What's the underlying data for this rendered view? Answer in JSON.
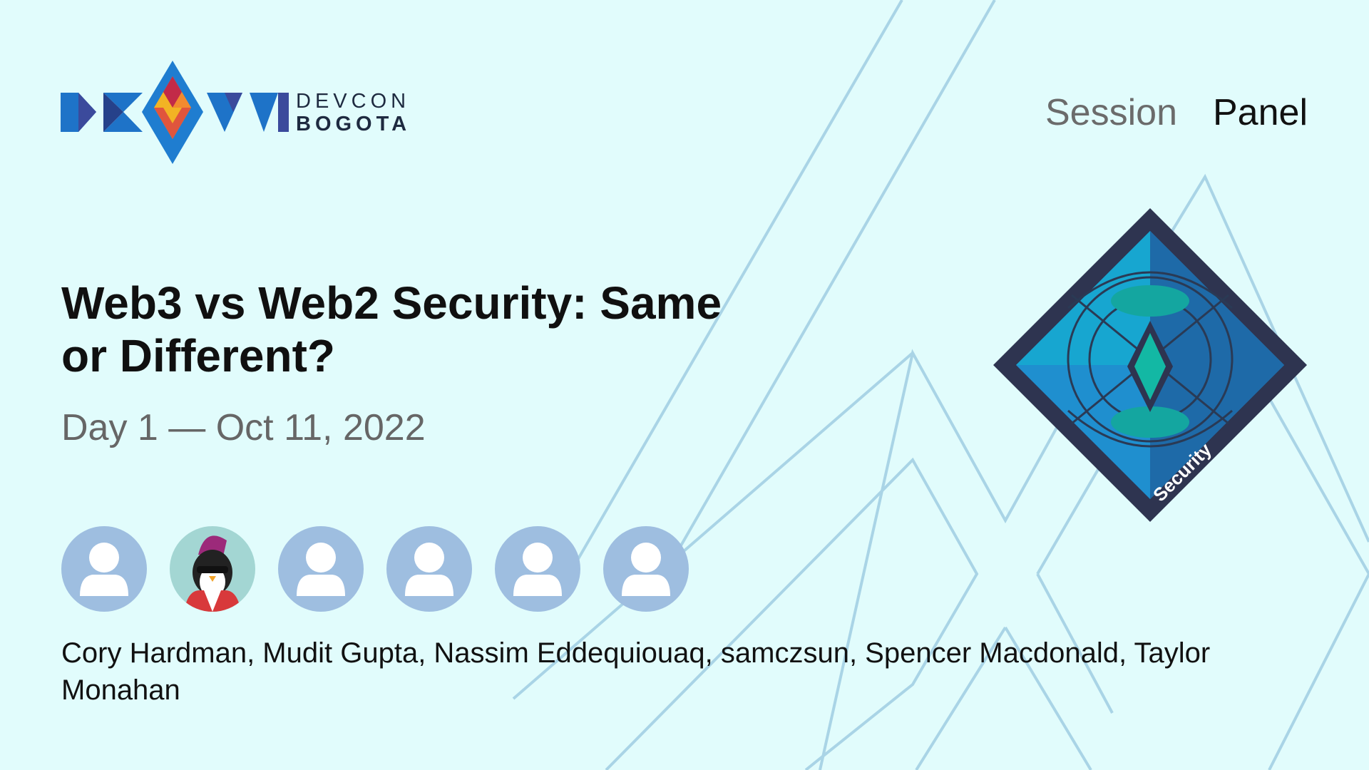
{
  "brand": {
    "line1": "DEVCON",
    "line2": "BOGOTA",
    "logo_icon": "devcon-bogota-logo"
  },
  "session_type": {
    "primary": "Session",
    "secondary": "Panel"
  },
  "title": "Web3 vs Web2 Security: Same or Different?",
  "date": "Day 1 — Oct 11, 2022",
  "speakers": {
    "text": "Cory Hardman, Mudit Gupta, Nassim Eddequiouaq, samczsun, Spencer Macdonald, Taylor Monahan",
    "avatars": [
      {
        "name": "Cory Hardman",
        "icon": "user-placeholder-icon"
      },
      {
        "name": "Mudit Gupta",
        "icon": "penguin-avatar"
      },
      {
        "name": "Nassim Eddequiouaq",
        "icon": "user-placeholder-icon"
      },
      {
        "name": "samczsun",
        "icon": "user-placeholder-icon"
      },
      {
        "name": "Spencer Macdonald",
        "icon": "user-placeholder-icon"
      },
      {
        "name": "Taylor Monahan",
        "icon": "user-placeholder-icon"
      }
    ]
  },
  "track_badge": {
    "label": "Security",
    "icon": "security-track-badge"
  },
  "colors": {
    "background": "#e1fcfc",
    "lines": "#a9d4e6",
    "avatar": "#9ebee0",
    "badge_dark": "#2e3450",
    "badge_blue": "#1f76c4"
  }
}
